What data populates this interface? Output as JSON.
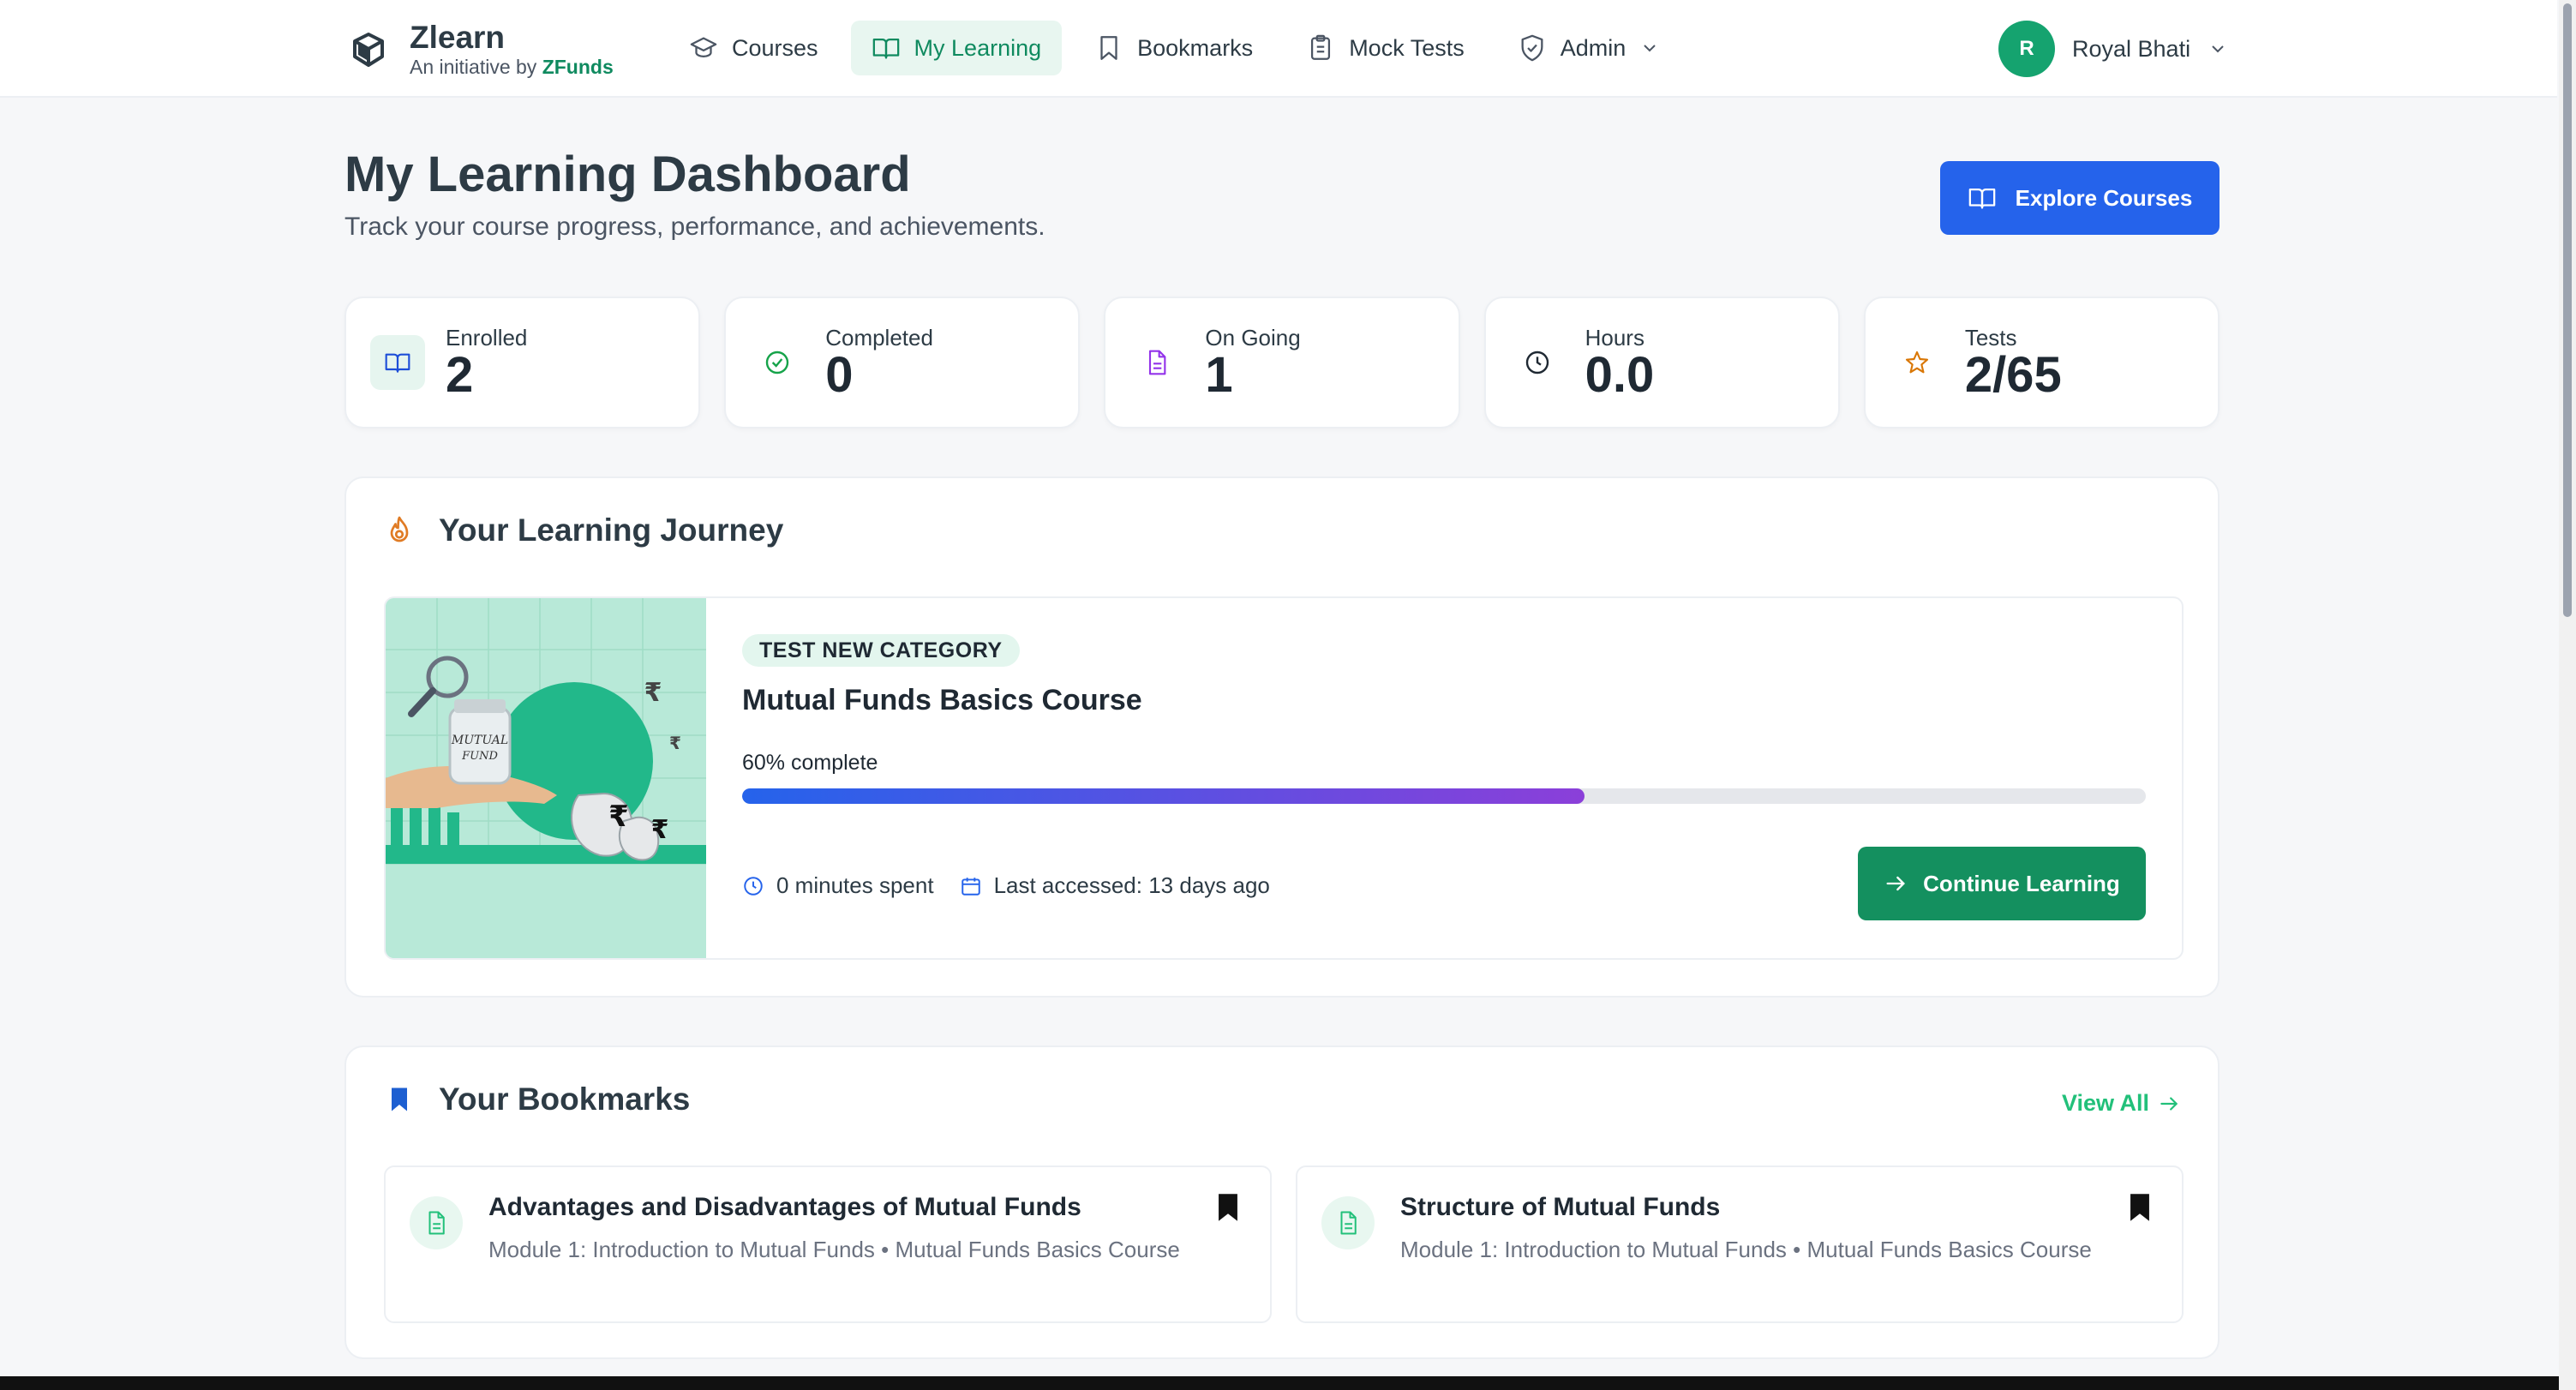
{
  "brand": {
    "name": "Zlearn",
    "tagline": "An initiative by",
    "tagline_brand": "ZFunds"
  },
  "nav": {
    "items": [
      {
        "label": "Courses",
        "icon": "graduation-cap-icon"
      },
      {
        "label": "My Learning",
        "icon": "open-book-icon",
        "active": true
      },
      {
        "label": "Bookmarks",
        "icon": "bookmark-icon"
      },
      {
        "label": "Mock Tests",
        "icon": "clipboard-icon"
      },
      {
        "label": "Admin",
        "icon": "shield-check-icon"
      }
    ]
  },
  "user": {
    "initial": "R",
    "name": "Royal Bhati"
  },
  "header": {
    "title": "My Learning Dashboard",
    "subtitle": "Track your course progress, performance, and achievements.",
    "explore_label": "Explore Courses"
  },
  "stats": [
    {
      "label": "Enrolled",
      "value": "2",
      "icon": "open-book-icon",
      "color": "#1d4ed8"
    },
    {
      "label": "Completed",
      "value": "0",
      "icon": "check-circle-icon",
      "color": "#16a34a"
    },
    {
      "label": "On Going",
      "value": "1",
      "icon": "document-icon",
      "color": "#9333ea"
    },
    {
      "label": "Hours",
      "value": "0.0",
      "icon": "clock-icon",
      "color": "#1f2933"
    },
    {
      "label": "Tests",
      "value": "2/65",
      "icon": "star-icon",
      "color": "#d97706"
    }
  ],
  "journey": {
    "title": "Your Learning Journey",
    "course": {
      "category": "TEST NEW CATEGORY",
      "title": "Mutual Funds Basics Course",
      "progress_label": "60% complete",
      "progress": 0.6,
      "time_spent": "0 minutes spent",
      "last_accessed": "Last accessed: 13 days ago",
      "continue_label": "Continue Learning",
      "thumb_jar_text_1": "MUTUAL",
      "thumb_jar_text_2": "FUND",
      "thumb_symbol": "₹"
    }
  },
  "bookmarks": {
    "title": "Your Bookmarks",
    "view_all": "View All",
    "items": [
      {
        "title": "Advantages and Disadvantages of Mutual Funds",
        "subtitle": "Module 1: Introduction to Mutual Funds • Mutual Funds Basics Course"
      },
      {
        "title": "Structure of Mutual Funds",
        "subtitle": "Module 1: Introduction to Mutual Funds • Mutual Funds Basics Course"
      }
    ]
  },
  "colors": {
    "brand_green": "#14905f",
    "primary_blue": "#2563eb",
    "accent_green": "#22c07a"
  }
}
